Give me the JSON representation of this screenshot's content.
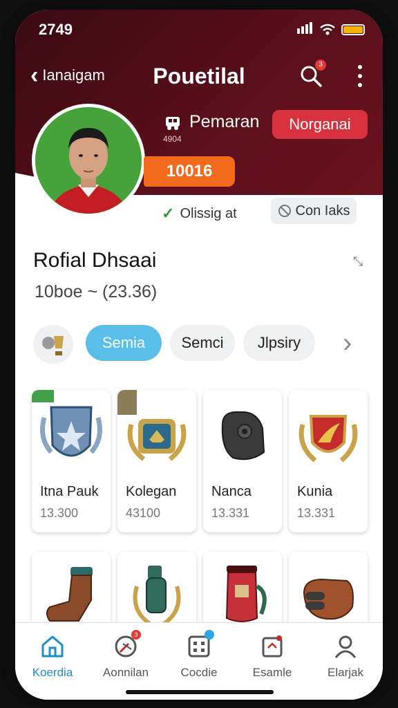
{
  "status_bar": {
    "time": "2749"
  },
  "top_bar": {
    "back_label": "Ianaigam",
    "title": "Pouetilal",
    "notification_count": "3"
  },
  "profile": {
    "name": "Pemaran",
    "user_id": "4904",
    "follow_button": "Norganai",
    "level_badge": "10016",
    "verified_text": "Olissig at",
    "contact_button": "Con Iaks"
  },
  "section": {
    "title": "Rofial Dhsaai",
    "subtitle": "10boe ~ (23.36)"
  },
  "filters": {
    "chips": [
      "Semia",
      "Semci",
      "Jlpsiry"
    ]
  },
  "items": [
    {
      "name": "Itna Pauk",
      "value": "13.300"
    },
    {
      "name": "Kolegan",
      "value": "43100"
    },
    {
      "name": "Nanca",
      "value": "13.331"
    },
    {
      "name": "Kunia",
      "value": "13.331"
    }
  ],
  "bottom_nav": [
    {
      "label": "Koerdia"
    },
    {
      "label": "Aonnilan",
      "badge": "3"
    },
    {
      "label": "Cocdie"
    },
    {
      "label": "Esamle"
    },
    {
      "label": "Elarjak"
    }
  ],
  "colors": {
    "hero": "#4a0d18",
    "accent": "#59bfe8",
    "follow": "#d9323f",
    "level": "#f26a1b",
    "nav_active": "#1a8fc7"
  }
}
